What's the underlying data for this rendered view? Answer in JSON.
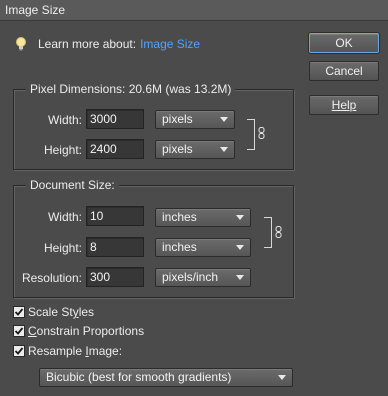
{
  "window": {
    "title": "Image Size"
  },
  "learn_more": {
    "label": "Learn more about:",
    "link": "Image Size"
  },
  "buttons": {
    "ok": "OK",
    "cancel": "Cancel",
    "help": "Help"
  },
  "pixel_dimensions": {
    "title": "Pixel Dimensions:  20.6M (was 13.2M)",
    "width_label": "Width:",
    "width_value": "3000",
    "width_unit": "pixels",
    "height_label": "Height:",
    "height_value": "2400",
    "height_unit": "pixels"
  },
  "document_size": {
    "title": "Document Size:",
    "width_label": "Width:",
    "width_value": "10",
    "width_unit": "inches",
    "height_label": "Height:",
    "height_value": "8",
    "height_unit": "inches",
    "resolution_label": "Resolution:",
    "resolution_value": "300",
    "resolution_unit": "pixels/inch"
  },
  "options": {
    "scale_styles": {
      "label_pre": "Scale St",
      "label_u": "y",
      "label_post": "les",
      "checked": true
    },
    "constrain": {
      "label_pre": "",
      "label_u": "C",
      "label_post": "onstrain Proportions",
      "checked": true
    },
    "resample": {
      "label_pre": "Resample ",
      "label_u": "I",
      "label_post": "mage:",
      "checked": true
    },
    "resample_method": "Bicubic (best for smooth gradients)"
  },
  "colors": {
    "background": "#4b4b4b",
    "link": "#4fa3ff",
    "ok_focus": "#6fa8e0"
  },
  "icons": {
    "bulb": "lightbulb-icon",
    "chain": "chain-link-icon",
    "check": "checkmark-icon",
    "dropdown": "chevron-down-icon"
  }
}
